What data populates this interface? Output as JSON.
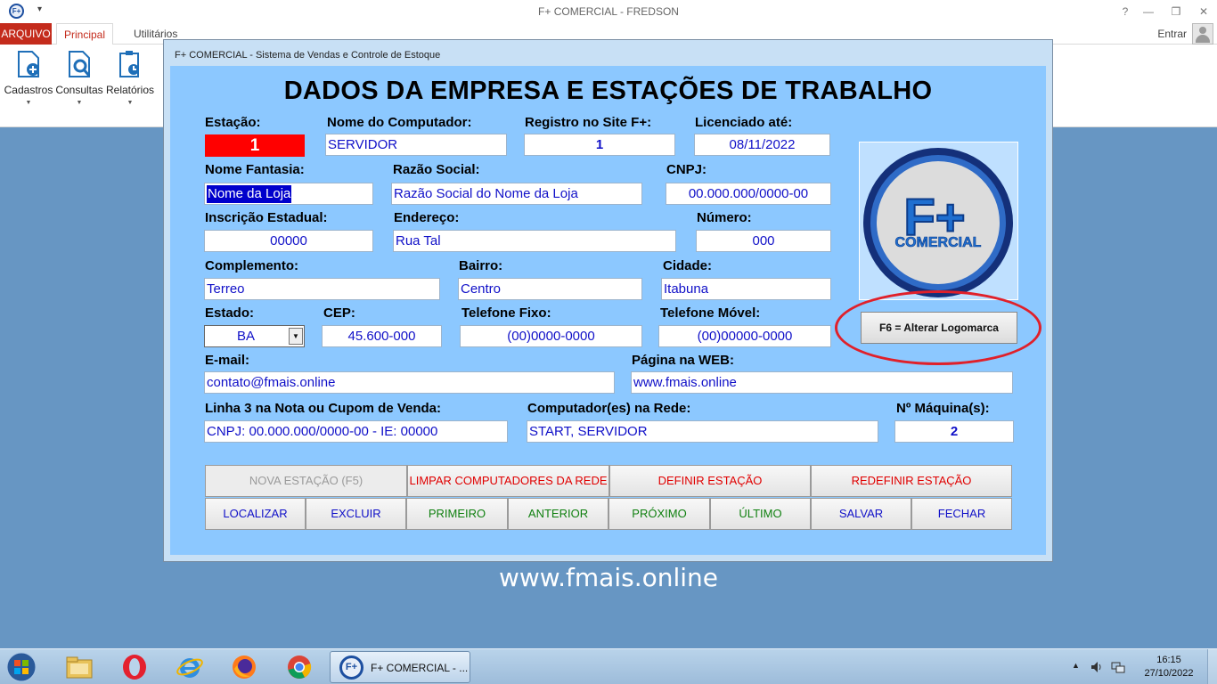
{
  "titlebar": {
    "title": "F+ COMERCIAL - FREDSON",
    "app_icon": "F+",
    "help": "?",
    "min": "—",
    "restore": "❒",
    "close": "✕"
  },
  "ribbon": {
    "tabs": {
      "file": "ARQUIVO",
      "main": "Principal",
      "utilities": "Utilitários"
    },
    "signin": "Entrar",
    "buttons": [
      {
        "label": "Cadastros",
        "icon": "register-icon"
      },
      {
        "label": "Consultas",
        "icon": "search-icon"
      },
      {
        "label": "Relatórios",
        "icon": "report-icon"
      }
    ],
    "dropdown_glyph": "▼",
    "colors": {
      "file_tab": "#c42b1c",
      "active_tab_text": "#c42b1c"
    }
  },
  "dialog": {
    "window_title": "F+ COMERCIAL - Sistema de Vendas e Controle de Estoque",
    "heading": "DADOS DA EMPRESA E ESTAÇÕES DE TRABALHO",
    "labels": {
      "estacao": "Estação:",
      "computador": "Nome do Computador:",
      "registro": "Registro no Site F+:",
      "licenciado": "Licenciado até:",
      "fantasia": "Nome Fantasia:",
      "razao": "Razão Social:",
      "cnpj": "CNPJ:",
      "ie": "Inscrição Estadual:",
      "endereco": "Endereço:",
      "numero": "Número:",
      "complemento": "Complemento:",
      "bairro": "Bairro:",
      "cidade": "Cidade:",
      "estado": "Estado:",
      "cep": "CEP:",
      "fone_fixo": "Telefone Fixo:",
      "fone_movel": "Telefone Móvel:",
      "email": "E-mail:",
      "web": "Página na WEB:",
      "linha3": "Linha 3 na Nota ou Cupom de Venda:",
      "rede": "Computador(es) na Rede:",
      "maquinas": "Nº Máquina(s):"
    },
    "values": {
      "estacao": "1",
      "computador": "SERVIDOR",
      "registro": "1",
      "licenciado": "08/11/2022",
      "fantasia": "Nome da Loja",
      "razao": "Razão Social do Nome da Loja",
      "cnpj": "00.000.000/0000-00",
      "ie": "00000",
      "endereco": "Rua Tal",
      "numero": "000",
      "complemento": "Terreo",
      "bairro": "Centro",
      "cidade": "Itabuna",
      "estado": "BA",
      "cep": "45.600-000",
      "fone_fixo": "(00)0000-0000",
      "fone_movel": "(00)00000-0000",
      "email": "contato@fmais.online",
      "web": "www.fmais.online",
      "linha3": "CNPJ: 00.000.000/0000-00 - IE: 00000",
      "rede": "START, SERVIDOR",
      "maquinas": "2"
    },
    "logo": {
      "big": "F+",
      "small": "COMERCIAL"
    },
    "logo_button": "F6 = Alterar Logomarca",
    "buttons_row1": [
      "NOVA ESTAÇÃO (F5)",
      "LIMPAR COMPUTADORES DA REDE",
      "DEFINIR ESTAÇÃO",
      "REDEFINIR ESTAÇÃO"
    ],
    "buttons_row2": [
      "LOCALIZAR",
      "EXCLUIR",
      "PRIMEIRO",
      "ANTERIOR",
      "PRÓXIMO",
      "ÚLTIMO",
      "SALVAR",
      "FECHAR"
    ],
    "colors": {
      "panel": "#8cc8ff",
      "field_text": "#1010c8",
      "station_field": "#ff0000",
      "highlight_ring": "#e0202a"
    }
  },
  "desktop": {
    "website": "www.fmais.online"
  },
  "taskbar": {
    "task_title": "F+ COMERCIAL - ...",
    "time": "16:15",
    "date": "27/10/2022",
    "icons": [
      "windows-start-icon",
      "file-explorer-icon",
      "opera-icon",
      "internet-explorer-icon",
      "firefox-icon",
      "chrome-icon"
    ],
    "tray_arrow": "▲"
  }
}
